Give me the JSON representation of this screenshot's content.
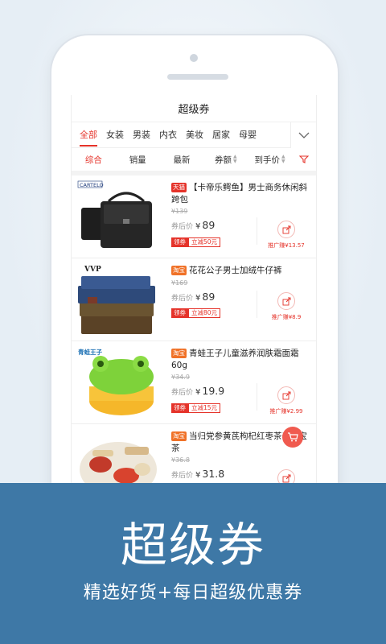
{
  "screen": {
    "title": "超级券",
    "categories": [
      "全部",
      "女装",
      "男装",
      "内衣",
      "美妆",
      "居家",
      "母婴"
    ],
    "sort_options": [
      "综合",
      "销量",
      "最新",
      "券额",
      "到手价"
    ],
    "products": [
      {
        "tag": "天猫",
        "title": "【卡帝乐鳄鱼】男士商务休闲斜跨包",
        "original_price": "¥139",
        "after_label": "券后价",
        "price": "89",
        "coupon_label": "领券",
        "coupon_amount": "立减50元",
        "share_label": "推广赚¥13.57",
        "brand": "CARTELO"
      },
      {
        "tag": "淘宝",
        "title": "花花公子男士加绒牛仔裤",
        "original_price": "¥169",
        "after_label": "券后价",
        "price": "89",
        "coupon_label": "领券",
        "coupon_amount": "立减80元",
        "share_label": "推广赚¥8.9",
        "brand": "VVP"
      },
      {
        "tag": "淘宝",
        "title": "青蛙王子儿童滋养润肤霜面霜60g",
        "original_price": "¥34.9",
        "after_label": "券后价",
        "price": "19.9",
        "coupon_label": "领券",
        "coupon_amount": "立减15元",
        "share_label": "推广赚¥2.99",
        "brand": "青蛙王子"
      },
      {
        "tag": "淘宝",
        "title": "当归党参黄芪枸杞红枣茶养生宝茶",
        "original_price": "¥36.8",
        "after_label": "券后价",
        "price": "31.8"
      }
    ]
  },
  "banner": {
    "title": "超级券",
    "subtitle": "精选好货+每日超级优惠券"
  },
  "colors": {
    "accent": "#e5332a",
    "banner": "#3e78a6"
  },
  "icons": [
    "chevron-down-icon",
    "filter-icon",
    "share-icon",
    "cart-icon"
  ]
}
